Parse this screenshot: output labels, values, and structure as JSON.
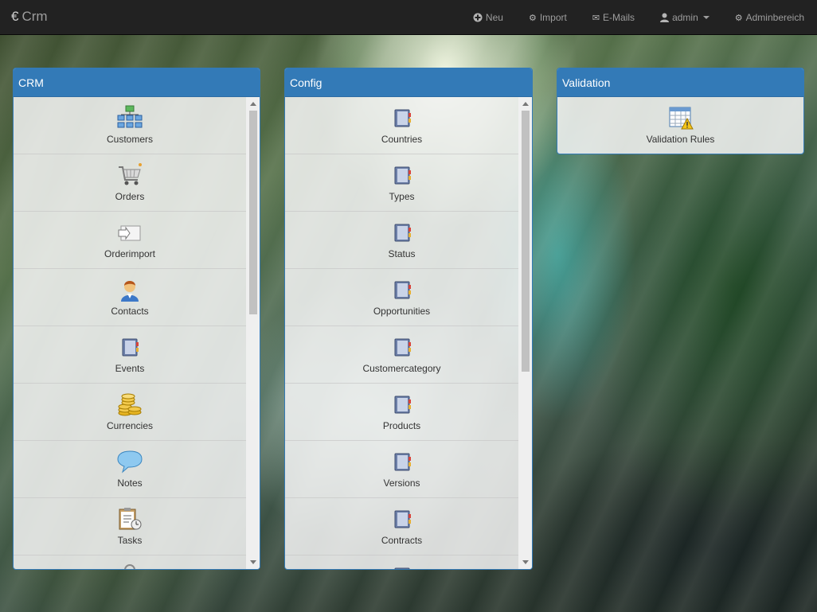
{
  "brand": {
    "symbol": "€",
    "title": "Crm"
  },
  "nav": {
    "new_label": "Neu",
    "import_label": "Import",
    "emails_label": "E-Mails",
    "user_label": "admin",
    "admin_label": "Adminbereich"
  },
  "panels": {
    "crm": {
      "title": "CRM",
      "items": [
        {
          "label": "Customers",
          "icon": "org-chart-icon"
        },
        {
          "label": "Orders",
          "icon": "shopping-cart-icon"
        },
        {
          "label": "Orderimport",
          "icon": "import-arrow-icon"
        },
        {
          "label": "Contacts",
          "icon": "person-icon"
        },
        {
          "label": "Events",
          "icon": "book-icon"
        },
        {
          "label": "Currencies",
          "icon": "coins-icon"
        },
        {
          "label": "Notes",
          "icon": "speech-bubble-icon"
        },
        {
          "label": "Tasks",
          "icon": "clipboard-clock-icon"
        }
      ]
    },
    "config": {
      "title": "Config",
      "items": [
        {
          "label": "Countries",
          "icon": "book-icon"
        },
        {
          "label": "Types",
          "icon": "book-icon"
        },
        {
          "label": "Status",
          "icon": "book-icon"
        },
        {
          "label": "Opportunities",
          "icon": "book-icon"
        },
        {
          "label": "Customercategory",
          "icon": "book-icon"
        },
        {
          "label": "Products",
          "icon": "book-icon"
        },
        {
          "label": "Versions",
          "icon": "book-icon"
        },
        {
          "label": "Contracts",
          "icon": "book-icon"
        }
      ]
    },
    "validation": {
      "title": "Validation",
      "items": [
        {
          "label": "Validation Rules",
          "icon": "table-warning-icon"
        }
      ]
    }
  },
  "colors": {
    "navbar": "#222222",
    "panel_header": "#337ab7",
    "nav_text": "#9d9d9d"
  }
}
